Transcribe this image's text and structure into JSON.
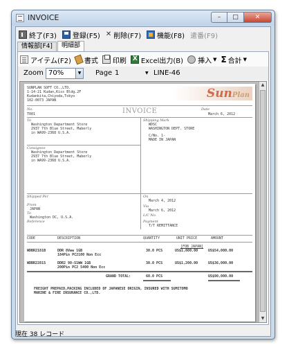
{
  "window": {
    "title": "INVOICE"
  },
  "toolbar": {
    "exit": "終了(F3)",
    "save": "登録(F5)",
    "delete": "削除(F7)",
    "function": "機能(F8)",
    "send": "遣番(F9)"
  },
  "tabs": [
    {
      "label": "情報部[F4]"
    },
    {
      "label": "明細部"
    }
  ],
  "subtoolbar": {
    "item": "アイテム(F2)",
    "memo": "書式",
    "print": "印刷",
    "excel": "Excel出力(B)",
    "insert": "挿入",
    "total": "合計"
  },
  "zoombar": {
    "zoom_label": "Zoom",
    "zoom_value": "70%",
    "page_label": "Page",
    "page_value": "1",
    "page_name": "LINE-46"
  },
  "invoice": {
    "company_name": "SUNPLAN SOFT CO.,LTD.",
    "address1": "1-14-21 Kudan,Kiss Bldg.2F",
    "address2": "Kudankita,Chiyoda,Tokyo",
    "address3": "102-0073 JAPAN",
    "logo_main": "Sun",
    "logo_tail": "Plan",
    "no_label": "No.",
    "no_value": "T001",
    "title": "INVOICE",
    "date_label": "Date",
    "date_value": "March 6, 2012",
    "to_label": "To",
    "to_line1": "Washington Department Store",
    "to_line2": "2937 7th Blue Street, Maberly",
    "to_line3": "in WA99-2368 U.S.A.",
    "shipping_label": "Shipping Mark",
    "ship_line1": "WDSC",
    "ship_line2": "WASHINGTON DEPT. STORE",
    "ship_line3": "C/No. 1-",
    "ship_line4": "MADE IN JAPAN",
    "consignee_label": "Consignee",
    "cons_line1": "Washington Department Store",
    "cons_line2": "2937 7th Blue Street, Maberly",
    "cons_line3": "in WA99-2368 U.S.A.",
    "shipped_label": "Shipped Per",
    "on_label": "On",
    "on_value": "March 4, 2012",
    "from_label": "From",
    "from_value": "JAPAN",
    "via_label": "Via",
    "via_value": "March 6, 2012",
    "to2_label": "To",
    "to2_value": "Washington DC, U.S.A.",
    "lc_label": "L/C No.",
    "reference_label": "Reference",
    "payment_label": "Payment",
    "payment_value": "T/T REMITTANCE",
    "col_code": "CODE",
    "col_desc": "DESCRIPTION",
    "col_qty": "QUANTITY",
    "col_unit": "UNIT PRICE",
    "col_amount": "AMOUNT",
    "terms": "[FOB JAPAN]",
    "rows": [
      {
        "code": "WDBR2181B",
        "desc1": "DDR 8Vww 1GB",
        "desc2": "184Pin PC2100 Non Ecc",
        "qty": "30.0 PCS",
        "unit": "US$1,800.00",
        "amount": "US$54,000.00"
      },
      {
        "code": "WDBR2281S",
        "desc1": "DDR2 90-S1WW 1GB",
        "desc2": "200Pin PC2 5400 Non Ecc",
        "qty": "30.0 PCS",
        "unit": "US$1,200.00",
        "amount": "US$36,000.00"
      }
    ],
    "grand_total_label": "GRAND TOTAL:",
    "grand_total_qty": "60.0 PCS",
    "grand_total_amount": "US$90,000.00",
    "note1": "FREIGHT PREPAID,PACKING INCLUDED OF JAPANESE ORIGIN, INSURED WITH SUMITOMO",
    "note2": "MARINE & FIRE INSURANCE CO.,LTD."
  },
  "status": {
    "text": "現在 38 レコード"
  }
}
